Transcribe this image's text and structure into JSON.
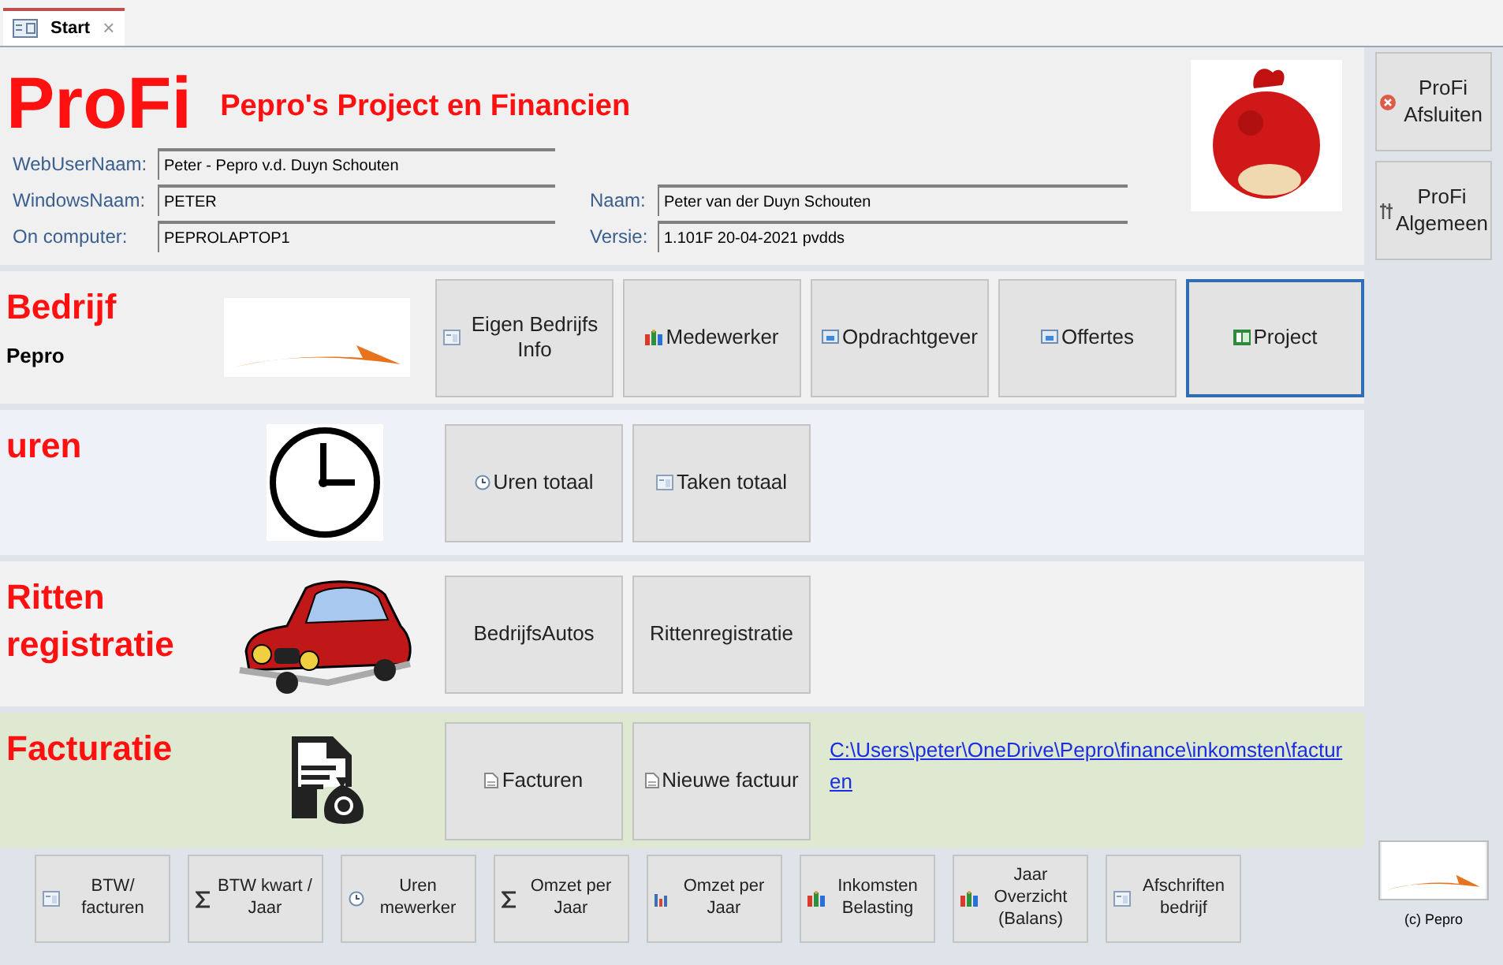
{
  "tab": {
    "label": "Start",
    "close": "×"
  },
  "header": {
    "title": "ProFi",
    "subtitle": "Pepro's Project en Financien",
    "fields_left": [
      {
        "label": "WebUserNaam:",
        "value": "Peter - Pepro v.d. Duyn Schouten"
      },
      {
        "label": "WindowsNaam:",
        "value": "PETER"
      },
      {
        "label": "On computer:",
        "value": "PEPROLAPTOP1"
      }
    ],
    "fields_right": [
      {
        "label": "Naam:",
        "value": "Peter van der Duyn Schouten"
      },
      {
        "label": "Versie:",
        "value": "1.101F 20-04-2021 pvdds"
      }
    ]
  },
  "side_buttons": [
    {
      "label": "ProFi Afsluiten",
      "kind": "close"
    },
    {
      "label": "ProFi Algemeen",
      "kind": "tools"
    }
  ],
  "sections": [
    {
      "title": "Bedrijf",
      "subtitle": "Pepro",
      "kind": "logo",
      "buttons": [
        {
          "label": "Eigen Bedrijfs Info",
          "kind": "form",
          "focused": false
        },
        {
          "label": "Medewerker",
          "kind": "people",
          "focused": false
        },
        {
          "label": "Opdrachtgever",
          "kind": "screen",
          "focused": false
        },
        {
          "label": "Offertes",
          "kind": "screen",
          "focused": false
        },
        {
          "label": "Project",
          "kind": "project",
          "focused": true
        }
      ]
    },
    {
      "title": "uren",
      "kind": "clock",
      "buttons": [
        {
          "label": "Uren totaal",
          "kind": "clock",
          "focused": false
        },
        {
          "label": "Taken totaal",
          "kind": "form",
          "focused": false
        }
      ]
    },
    {
      "title": "Ritten registratie",
      "kind": "car",
      "buttons": [
        {
          "label": "BedrijfsAutos",
          "kind": "none",
          "focused": false
        },
        {
          "label": "Rittenregistratie",
          "kind": "none",
          "focused": false
        }
      ]
    },
    {
      "title": "Facturatie",
      "kind": "invoice",
      "buttons": [
        {
          "label": "Facturen",
          "kind": "doc",
          "focused": false
        },
        {
          "label": "Nieuwe factuur",
          "kind": "doc",
          "focused": false
        }
      ],
      "link": "C:\\Users\\peter\\OneDrive\\Pepro\\finance\\inkomsten\\facturen"
    }
  ],
  "bottom_buttons": [
    {
      "label": "BTW/ facturen",
      "kind": "form"
    },
    {
      "label": "BTW kwart / Jaar",
      "kind": "sigma"
    },
    {
      "label": "Uren mewerker",
      "kind": "clock"
    },
    {
      "label": "Omzet per Jaar",
      "kind": "sigma"
    },
    {
      "label": "Omzet per Jaar",
      "kind": "chart"
    },
    {
      "label": "Inkomsten Belasting",
      "kind": "people"
    },
    {
      "label": "Jaar Overzicht (Balans)",
      "kind": "people"
    },
    {
      "label": "Afschriften bedrijf",
      "kind": "form"
    }
  ],
  "copyright": "(c) Pepro"
}
